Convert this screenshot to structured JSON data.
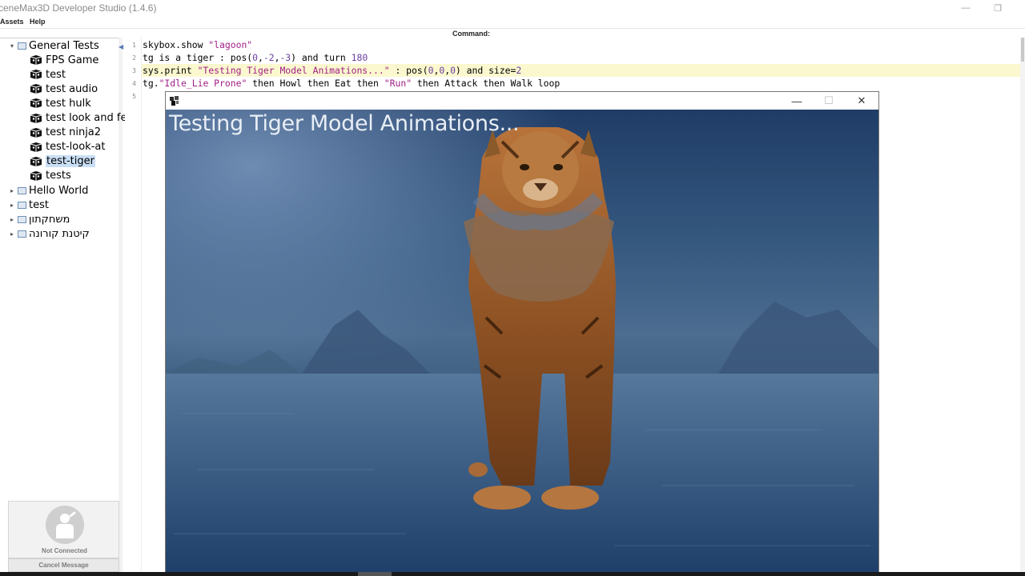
{
  "window": {
    "title": "ceneMax3D Developer Studio (1.4.6)",
    "controls": {
      "minimize": "—",
      "restore": "❐"
    }
  },
  "menu": {
    "items": [
      "Assets",
      "Help"
    ],
    "command_label": "Command:"
  },
  "tree": {
    "items": [
      {
        "label": "General Tests",
        "type": "folder",
        "expanded": true
      },
      {
        "label": "FPS Game",
        "type": "file"
      },
      {
        "label": "test",
        "type": "file"
      },
      {
        "label": "test audio",
        "type": "file"
      },
      {
        "label": "test hulk",
        "type": "file"
      },
      {
        "label": "test look and fe",
        "type": "file"
      },
      {
        "label": "test ninja2",
        "type": "file"
      },
      {
        "label": "test-look-at",
        "type": "file"
      },
      {
        "label": "test-tiger",
        "type": "file",
        "selected": true
      },
      {
        "label": "tests",
        "type": "file"
      },
      {
        "label": "Hello World",
        "type": "folder",
        "expanded": false
      },
      {
        "label": "test",
        "type": "folder",
        "expanded": false
      },
      {
        "label": "משחקתון",
        "type": "folder",
        "expanded": false
      },
      {
        "label": "קיטנת קורונה",
        "type": "folder",
        "expanded": false
      }
    ]
  },
  "status": {
    "text": "Not Connected",
    "cancel_label": "Cancel Message"
  },
  "editor": {
    "line_numbers": [
      "1",
      "2",
      "3",
      "4",
      "5"
    ],
    "lines": [
      [
        {
          "t": "skybox.show "
        },
        {
          "t": "\"lagoon\"",
          "k": "str"
        }
      ],
      [
        {
          "t": "tg is a tiger : pos("
        },
        {
          "t": "0",
          "k": "num"
        },
        {
          "t": ","
        },
        {
          "t": "-2",
          "k": "num"
        },
        {
          "t": ","
        },
        {
          "t": "-3",
          "k": "num"
        },
        {
          "t": ") and turn "
        },
        {
          "t": "180",
          "k": "num"
        }
      ],
      [
        {
          "t": "sys.print "
        },
        {
          "t": "\"Testing Tiger Model Animations...\"",
          "k": "str"
        },
        {
          "t": " : pos("
        },
        {
          "t": "0",
          "k": "num"
        },
        {
          "t": ","
        },
        {
          "t": "0",
          "k": "num"
        },
        {
          "t": ","
        },
        {
          "t": "0",
          "k": "num"
        },
        {
          "t": ") and size="
        },
        {
          "t": "2",
          "k": "num"
        }
      ],
      [
        {
          "t": "tg."
        },
        {
          "t": "\"Idle_Lie Prone\"",
          "k": "str"
        },
        {
          "t": " then Howl then Eat then "
        },
        {
          "t": "\"Run\"",
          "k": "str"
        },
        {
          "t": " then Attack then Walk loop"
        }
      ],
      []
    ]
  },
  "render_window": {
    "overlay_text": "Testing Tiger Model Animations...",
    "controls": {
      "minimize": "—",
      "maximize": "☐",
      "close": "✕"
    }
  },
  "colors": {
    "string": "#a01e86",
    "number": "#6b3fa0",
    "highlight_line": "#fbf8cf",
    "selection": "#c9dff5"
  }
}
